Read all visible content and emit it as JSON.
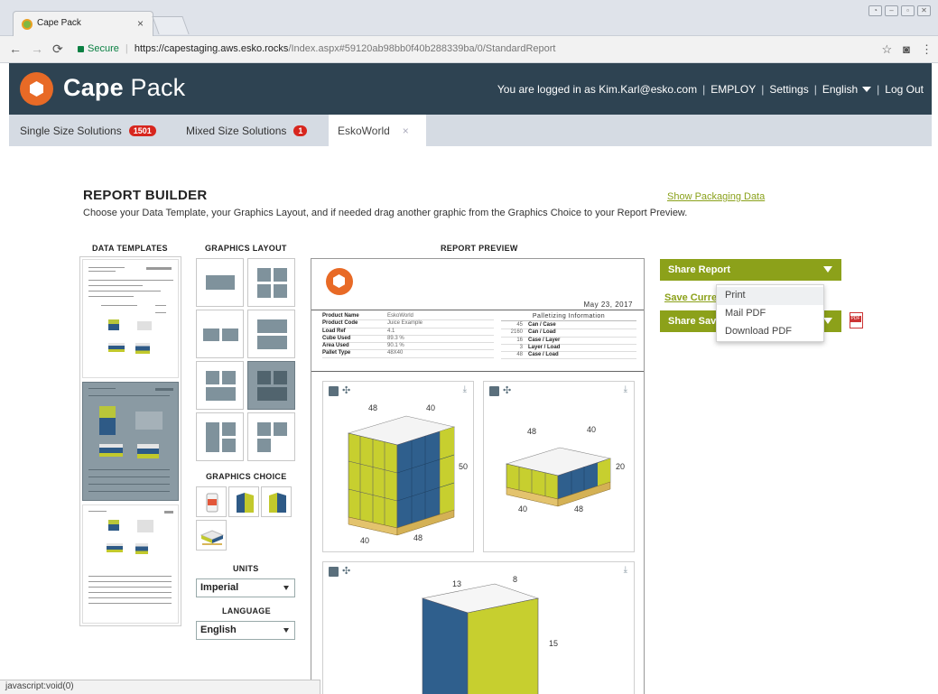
{
  "browser": {
    "tab_title": "Cape Pack",
    "tab_close": "×",
    "secure_label": "Secure",
    "url_host": "https://capestaging.aws.esko.rocks",
    "url_path": "/Index.aspx#59120ab98bb0f40b288339ba/0/StandardReport"
  },
  "header": {
    "brand_bold": "Cape",
    "brand_light": " Pack",
    "logged_in": "You are logged in as Kim.Karl@esko.com",
    "employ": "EMPLOY",
    "settings": "Settings",
    "language": "English",
    "logout": "Log Out",
    "sep": "|"
  },
  "tabs": {
    "single": {
      "label": "Single Size Solutions",
      "count": "1501"
    },
    "mixed": {
      "label": "Mixed Size Solutions",
      "count": "1"
    },
    "active": {
      "label": "EskoWorld",
      "close": "×"
    }
  },
  "builder": {
    "title": "REPORT BUILDER",
    "subtitle": "Choose your Data Template, your Graphics Layout, and if needed drag another graphic from the Graphics Choice to your Report Preview.",
    "show_packaging": "Show Packaging Data",
    "data_templates": "DATA TEMPLATES",
    "graphics_layout": "GRAPHICS LAYOUT",
    "report_preview": "REPORT PREVIEW",
    "graphics_choice": "GRAPHICS CHOICE",
    "units_label": "UNITS",
    "units_value": "Imperial",
    "language_label": "LANGUAGE",
    "language_value": "English"
  },
  "preview": {
    "date": "May 23, 2017",
    "product": [
      {
        "k": "Product Name",
        "v": "EskoWorld"
      },
      {
        "k": "Product Code",
        "v": "Juice Example"
      },
      {
        "k": "Load Ref",
        "v": "4.1"
      },
      {
        "k": "Cube Used",
        "v": "89.3 %"
      },
      {
        "k": "Area Used",
        "v": "90.1 %"
      },
      {
        "k": "Pallet Type",
        "v": "48X40"
      }
    ],
    "palletizing_title": "Palletizing Information",
    "palletizing": [
      {
        "n": "45",
        "l": "Can / Case"
      },
      {
        "n": "2160",
        "l": "Can / Load"
      },
      {
        "n": "16",
        "l": "Case / Layer"
      },
      {
        "n": "3",
        "l": "Layer / Load"
      },
      {
        "n": "48",
        "l": "Case / Load"
      }
    ],
    "graphic1": {
      "top_left": "48",
      "top_right": "40",
      "side": "50",
      "bottom_left": "40",
      "bottom_right": "48"
    },
    "graphic2": {
      "top_left": "48",
      "top_right": "40",
      "side": "20",
      "bottom_left": "40",
      "bottom_right": "48"
    },
    "graphic3": {
      "top_left": "13",
      "top_right": "8",
      "side": "15"
    },
    "download_glyph": "⤓",
    "move_glyph": "✣"
  },
  "share": {
    "share_report": "Share Report",
    "save_current": "Save Curre",
    "share_saved": "Share Sav",
    "menu": [
      "Print",
      "Mail PDF",
      "Download PDF"
    ],
    "pdf_badge": "PDF"
  },
  "status": {
    "text": "javascript:void(0)"
  },
  "colors": {
    "header_bg": "#2e4352",
    "accent_green": "#8ca11a",
    "logo_orange": "#e86a26",
    "badge_red": "#d7261e",
    "case_blue": "#2e5a86",
    "case_yellow": "#c2c92c"
  }
}
